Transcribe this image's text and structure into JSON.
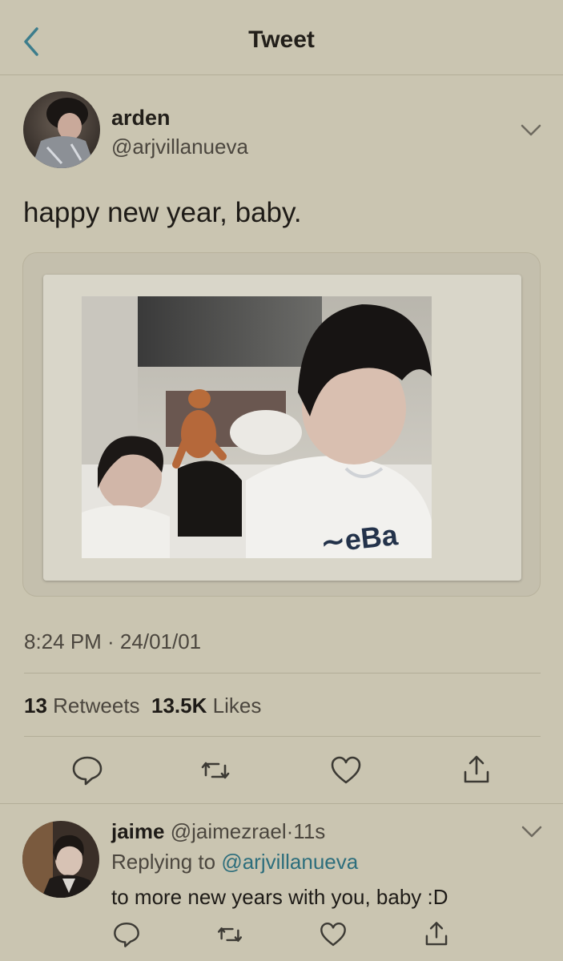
{
  "colors": {
    "background": "#cac5b1",
    "accent": "#3c7d8c",
    "link": "#2d6e7c",
    "muted": "#4b463e"
  },
  "header": {
    "back_icon": "chevron-left-icon",
    "title": "Tweet"
  },
  "tweet": {
    "display_name": "arden",
    "handle": "@arjvillanueva",
    "text": "happy new year, baby.",
    "timestamp": "8:24 PM · 24/01/01",
    "retweet_count": "13",
    "retweets_label": "Retweets",
    "like_count": "13.5K",
    "likes_label": "Likes",
    "menu_icon": "chevron-down-icon"
  },
  "actions": [
    {
      "name": "reply",
      "icon": "speech-bubble-icon"
    },
    {
      "name": "retweet",
      "icon": "retweet-icon"
    },
    {
      "name": "like",
      "icon": "heart-icon"
    },
    {
      "name": "share",
      "icon": "share-icon"
    }
  ],
  "reply": {
    "display_name": "jaime",
    "handle": "@jaimezrael",
    "separator": "·",
    "time": "11s",
    "replying_prefix": "Replying to",
    "replying_to": "@arjvillanueva",
    "text": "to more new years with you, baby :D"
  }
}
